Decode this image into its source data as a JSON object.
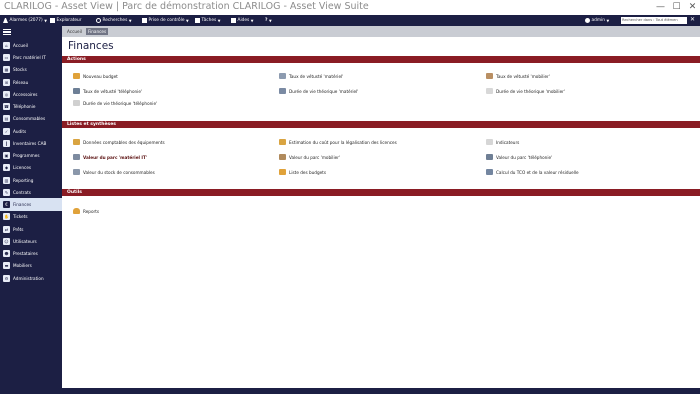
{
  "window": {
    "title": "CLARILOG - Asset View | Parc de démonstration CLARILOG - Asset View Suite",
    "minimize": "—",
    "maximize": "☐",
    "close": "✕"
  },
  "topnav": {
    "alarms": "Alarmes (2077)",
    "explorer": "Explorateur",
    "searches": "Recherches",
    "control_panel": "Prise de contrôle",
    "tasks": "Tâches",
    "help_label": "Aides",
    "help_icon": "?",
    "user": "admin",
    "search_placeholder": "Rechercher dans : Tout élémen",
    "close": "✕",
    "colors": {
      "bar": "#1c1f44"
    }
  },
  "sidebar": {
    "items": [
      {
        "label": "Accueil",
        "icon": "home-icon",
        "glyph": "⌂"
      },
      {
        "label": "Parc matériel IT",
        "icon": "computer-icon",
        "glyph": "▭"
      },
      {
        "label": "Stocks",
        "icon": "stock-icon",
        "glyph": "▦"
      },
      {
        "label": "Réseau",
        "icon": "network-icon",
        "glyph": "⊞"
      },
      {
        "label": "Accessoires",
        "icon": "accessories-icon",
        "glyph": "◎"
      },
      {
        "label": "Téléphonie",
        "icon": "phone-icon",
        "glyph": "☎"
      },
      {
        "label": "Consommables",
        "icon": "consumables-icon",
        "glyph": "▤"
      },
      {
        "label": "Audits",
        "icon": "audit-icon",
        "glyph": "✓"
      },
      {
        "label": "Inventaires CAB",
        "icon": "barcode-icon",
        "glyph": "‖"
      },
      {
        "label": "Programmes",
        "icon": "programs-icon",
        "glyph": "▣"
      },
      {
        "label": "Licences",
        "icon": "license-icon",
        "glyph": "◆"
      },
      {
        "label": "Reporting",
        "icon": "reporting-icon",
        "glyph": "▥"
      },
      {
        "label": "Contrats",
        "icon": "contract-icon",
        "glyph": "✎"
      },
      {
        "label": "Finances",
        "icon": "finance-icon",
        "glyph": "€",
        "active": true
      },
      {
        "label": "Tickets",
        "icon": "ticket-icon",
        "glyph": "✋"
      },
      {
        "label": "Prêts",
        "icon": "loan-icon",
        "glyph": "⇄"
      },
      {
        "label": "Utilisateurs",
        "icon": "users-icon",
        "glyph": "☺"
      },
      {
        "label": "Prestataires",
        "icon": "providers-icon",
        "glyph": "☻"
      },
      {
        "label": "Mobiliers",
        "icon": "furniture-icon",
        "glyph": "▬"
      },
      {
        "label": "Administration",
        "icon": "admin-icon",
        "glyph": "⚙"
      }
    ],
    "colors": {
      "active_bg": "#d8e2f2"
    }
  },
  "breadcrumb": {
    "home": "Accueil",
    "current": "Finances"
  },
  "page": {
    "title": "Finances"
  },
  "sections": {
    "actions": {
      "title": "Actions",
      "items": [
        {
          "label": "Nouveau budget",
          "icon": "budget-icon"
        },
        {
          "label": "Taux de vétusté 'matériel'",
          "icon": "rate-hardware-icon"
        },
        {
          "label": "Taux de vétusté 'mobilier'",
          "icon": "rate-furniture-icon"
        },
        {
          "label": "Taux de vétusté 'téléphonie'",
          "icon": "rate-phone-icon"
        },
        {
          "label": "Durée de vie théorique 'matériel'",
          "icon": "lifespan-hardware-icon"
        },
        {
          "label": "Durée de vie théorique 'mobilier'",
          "icon": "lifespan-furniture-icon"
        },
        {
          "label": "Durée de vie théorique 'téléphonie'",
          "icon": "lifespan-phone-icon"
        }
      ]
    },
    "lists": {
      "title": "Listes et synthèses",
      "items": [
        {
          "label": "Données comptables des équipements",
          "icon": "accounting-icon"
        },
        {
          "label": "Estimation du coût pour la légalisation des licences",
          "icon": "license-cost-icon"
        },
        {
          "label": "Indicateurs",
          "icon": "indicators-icon"
        },
        {
          "label": "Valeur du parc 'matériel IT'",
          "icon": "value-hardware-icon"
        },
        {
          "label": "Valeur du parc 'mobilier'",
          "icon": "value-furniture-icon"
        },
        {
          "label": "Valeur du parc 'téléphonie'",
          "icon": "value-phone-icon"
        },
        {
          "label": "Valeur du stock de consommables",
          "icon": "value-stock-icon"
        },
        {
          "label": "Liste des budgets",
          "icon": "budget-list-icon"
        },
        {
          "label": "Calcul du TCO et de la valeur résiduelle",
          "icon": "tco-icon"
        }
      ]
    },
    "tools": {
      "title": "Outils",
      "items": [
        {
          "label": "Reports",
          "icon": "reports-icon"
        }
      ]
    },
    "colors": {
      "header_bg": "#8a1c24"
    }
  }
}
